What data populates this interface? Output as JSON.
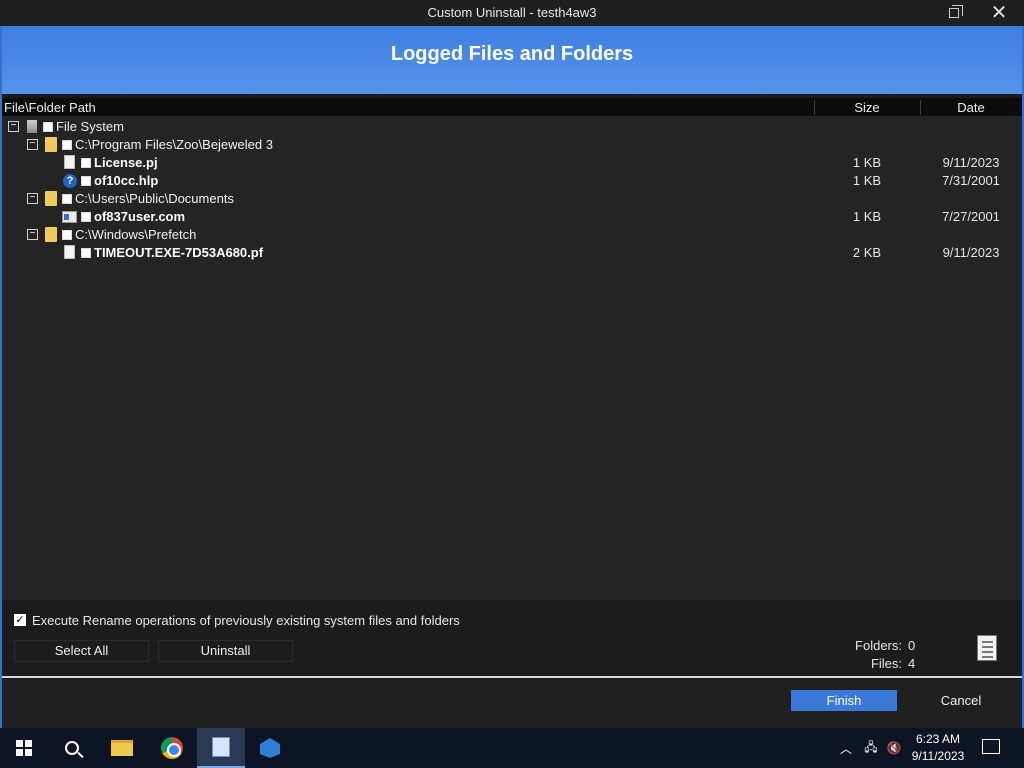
{
  "window": {
    "title": "Custom Uninstall - testh4aw3",
    "heading": "Logged Files and Folders"
  },
  "columns": {
    "path": "File\\Folder Path",
    "size": "Size",
    "date": "Date"
  },
  "tree": [
    {
      "label": "File System",
      "bold": false,
      "size": "",
      "date": ""
    },
    {
      "label": "C:\\Program Files\\Zoo\\Bejeweled 3",
      "bold": false,
      "size": "",
      "date": ""
    },
    {
      "label": "License.pj",
      "bold": true,
      "size": "1 KB",
      "date": "9/11/2023"
    },
    {
      "label": "of10cc.hlp",
      "bold": true,
      "size": "1 KB",
      "date": "7/31/2001"
    },
    {
      "label": "C:\\Users\\Public\\Documents",
      "bold": false,
      "size": "",
      "date": ""
    },
    {
      "label": "of837user.com",
      "bold": true,
      "size": "1 KB",
      "date": "7/27/2001"
    },
    {
      "label": "C:\\Windows\\Prefetch",
      "bold": false,
      "size": "",
      "date": ""
    },
    {
      "label": "TIMEOUT.EXE-7D53A680.pf",
      "bold": true,
      "size": "2 KB",
      "date": "9/11/2023"
    }
  ],
  "options": {
    "rename_checkbox_label": "Execute Rename operations of previously existing system files and folders",
    "rename_checked": true
  },
  "buttons": {
    "select_all": "Select All",
    "uninstall": "Uninstall",
    "finish": "Finish",
    "cancel": "Cancel"
  },
  "stats": {
    "folders_label": "Folders:",
    "folders_value": "0",
    "files_label": "Files:",
    "files_value": "4"
  },
  "taskbar": {
    "time": "6:23 AM",
    "date": "9/11/2023",
    "items": [
      "start-icon",
      "search-icon",
      "file-explorer-icon",
      "chrome-icon",
      "uninstaller-app-icon",
      "setup-app-icon"
    ]
  },
  "colors": {
    "accent": "#3b79d8",
    "banner": "#4a88e6",
    "folder": "#f0cc5a"
  }
}
